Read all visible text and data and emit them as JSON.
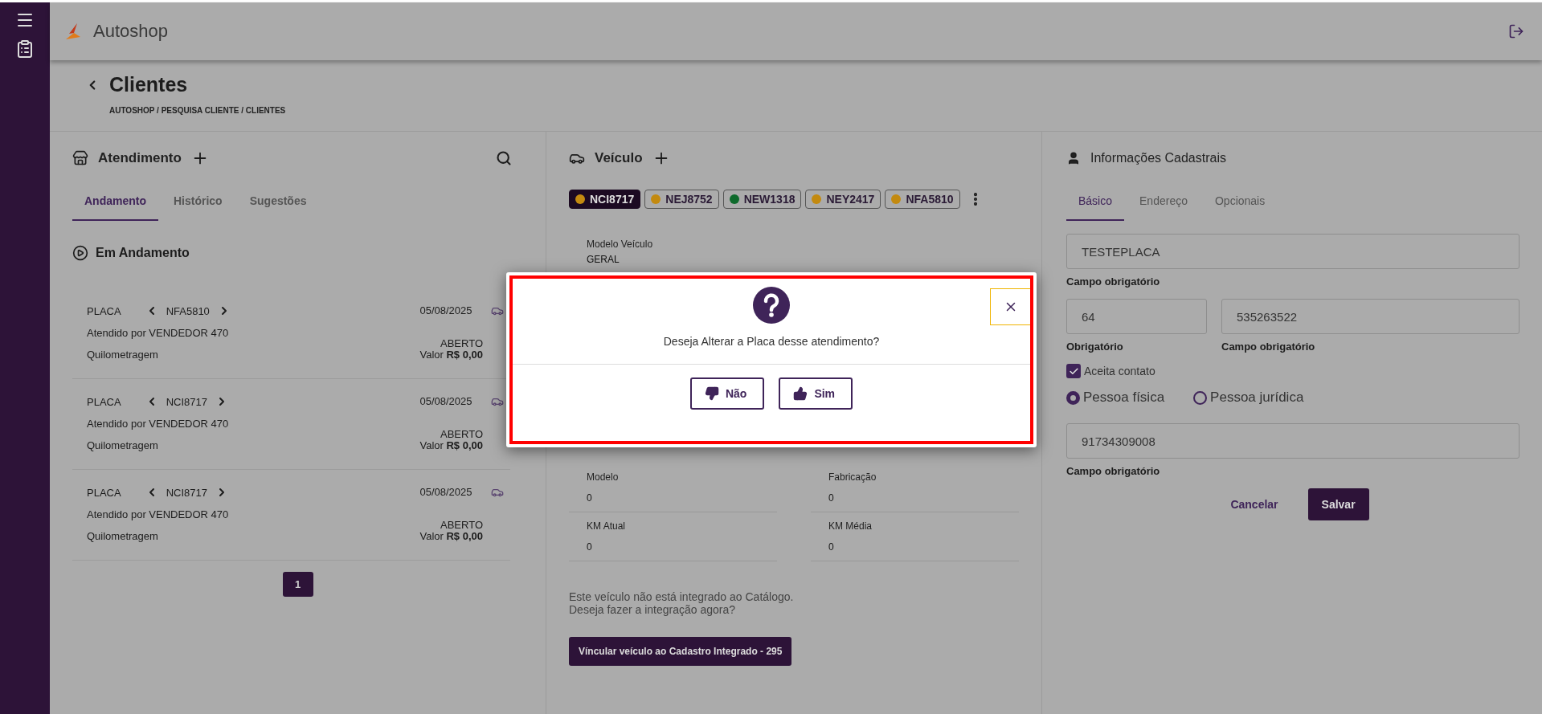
{
  "header": {
    "app_name": "Autoshop"
  },
  "page": {
    "title": "Clientes",
    "breadcrumb": "AUTOSHOP / PESQUISA CLIENTE / CLIENTES"
  },
  "atendimento": {
    "title": "Atendimento",
    "tabs": [
      {
        "label": "Andamento",
        "selected": true
      },
      {
        "label": "Histórico",
        "selected": false
      },
      {
        "label": "Sugestões",
        "selected": false
      }
    ],
    "section_title": "Em Andamento",
    "cards": [
      {
        "plate_label": "PLACA",
        "plate": "NFA5810",
        "date": "05/08/2025",
        "attended_by": "Atendido por VENDEDOR 470",
        "mileage_label": "Quilometragem",
        "status": "ABERTO",
        "value": "Valor **R$ 0,00**"
      },
      {
        "plate_label": "PLACA",
        "plate": "NCI8717",
        "date": "05/08/2025",
        "attended_by": "Atendido por VENDEDOR 470",
        "mileage_label": "Quilometragem",
        "status": "ABERTO",
        "value": "Valor **R$ 0,00**"
      },
      {
        "plate_label": "PLACA",
        "plate": "NCI8717",
        "date": "05/08/2025",
        "attended_by": "Atendido por VENDEDOR 470",
        "mileage_label": "Quilometragem",
        "status": "ABERTO",
        "value": "Valor **R$ 0,00**"
      }
    ],
    "pagination": [
      {
        "label": "1",
        "selected": true
      }
    ]
  },
  "veiculo": {
    "title": "Veículo",
    "plates": [
      {
        "label": "NCI8717",
        "color": "#c38a10",
        "selected": true
      },
      {
        "label": "NEJ8752",
        "color": "#c38a10",
        "selected": false
      },
      {
        "label": "NEW1318",
        "color": "#0e6a2c",
        "selected": false
      },
      {
        "label": "NEY2417",
        "color": "#c38a10",
        "selected": false
      },
      {
        "label": "NFA5810",
        "color": "#c38a10",
        "selected": false
      }
    ],
    "top_field": {
      "label": "Modelo Veículo",
      "value": "GERAL"
    },
    "fields": [
      {
        "label": "Modelo",
        "value": "0"
      },
      {
        "label": "Fabricação",
        "value": "0"
      },
      {
        "label": "KM Atual",
        "value": "0"
      },
      {
        "label": "KM Média",
        "value": "0"
      }
    ],
    "notice": [
      "Este veículo não está integrado ao Catálogo.",
      "Deseja fazer a integração agora?"
    ],
    "link_button": "Víncular veículo ao Cadastro Integrado - 295"
  },
  "cadastro": {
    "title": "Informações Cadastrais",
    "tabs": [
      {
        "label": "Básico",
        "selected": true
      },
      {
        "label": "Endereço",
        "selected": false
      },
      {
        "label": "Opcionais",
        "selected": false
      }
    ],
    "name_field": {
      "value": "TESTEPLACA",
      "helper": "Campo obrigatório"
    },
    "phone_fields": [
      {
        "value": "64",
        "helper": "Obrigatório"
      },
      {
        "value": "535263522",
        "helper": "Campo obrigatório"
      }
    ],
    "contact": {
      "label": "Aceita contato",
      "checked": true
    },
    "person_type": [
      {
        "label": "Pessoa física",
        "selected": true
      },
      {
        "label": "Pessoa jurídica",
        "selected": false
      }
    ],
    "document_field": {
      "value": "91734309008",
      "helper": "Campo obrigatório"
    },
    "buttons": [
      {
        "label": "Cancelar",
        "kind": "text"
      },
      {
        "label": "Salvar",
        "kind": "filled"
      }
    ]
  },
  "dialog": {
    "message": "Deseja Alterar a Placa desse atendimento?",
    "buttons": [
      {
        "label": "Não",
        "kind": "no"
      },
      {
        "label": "Sim",
        "kind": "yes"
      }
    ]
  }
}
